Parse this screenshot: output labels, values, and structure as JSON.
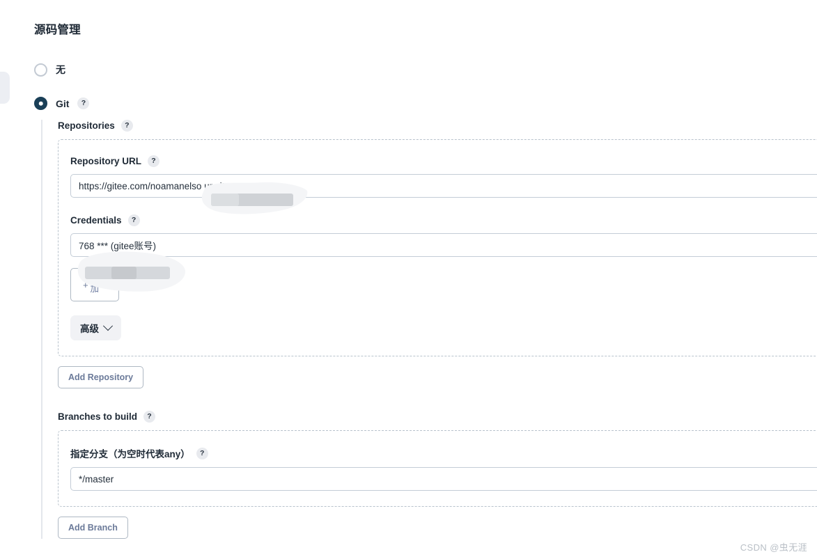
{
  "page": {
    "title": "源码管理"
  },
  "scm_options": [
    {
      "label": "无",
      "selected": false,
      "has_help": false
    },
    {
      "label": "Git",
      "selected": true,
      "has_help": true
    }
  ],
  "git": {
    "repositories_label": "Repositories",
    "repository": {
      "url_label": "Repository URL",
      "url_value": "https://gitee.com/noamanelso                    ur.git",
      "credentials_label": "Credentials",
      "credentials_value": "768                         *** (gitee账号)",
      "add_button": {
        "plus": "+",
        "line1": "添",
        "line2": "加"
      },
      "advanced_label": "高级"
    },
    "add_repository_label": "Add Repository",
    "branches_label": "Branches to build",
    "branch": {
      "specifier_label": "指定分支（为空时代表any）",
      "specifier_value": "*/master"
    },
    "add_branch_label": "Add Branch"
  },
  "help_glyph": "?",
  "watermark": "CSDN @虫无涯",
  "colors": {
    "accent_selected": "#1a3f57",
    "border": "#c3ccd6",
    "dashed_border": "#b8c2cc",
    "muted_button_text": "#6b7a99",
    "pill_bg": "#f1f2f5",
    "watermark": "#b9bfc6"
  }
}
